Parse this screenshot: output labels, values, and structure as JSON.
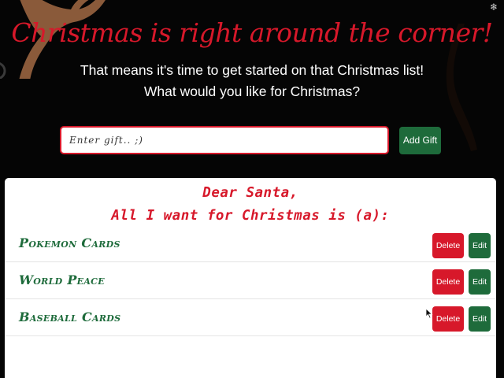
{
  "header": {
    "title": "Christmas is right around the corner!",
    "subtitle_line1": "That means it's time to get started on that Christmas list!",
    "subtitle_line2": "What would you like for Christmas?"
  },
  "snow_toggle": {
    "icon": "snowflake-icon",
    "glyph": "❄"
  },
  "gift_form": {
    "input_value": "",
    "input_placeholder": "Enter gift.. ;)",
    "add_button_label": "Add Gift"
  },
  "wishlist": {
    "heading_line1": "Dear Santa,",
    "heading_line2": "All I want for Christmas is (a):",
    "items": [
      {
        "label": "Pokemon Cards",
        "delete_label": "Delete",
        "edit_label": "Edit"
      },
      {
        "label": "World Peace",
        "delete_label": "Delete",
        "edit_label": "Edit"
      },
      {
        "label": "Baseball Cards",
        "delete_label": "Delete",
        "edit_label": "Edit"
      }
    ]
  },
  "colors": {
    "background": "#050505",
    "christmas_red": "#d7182a",
    "christmas_green": "#1e6b3b",
    "card_background": "#ffffff",
    "reindeer_brown": "#8a5a3a"
  }
}
